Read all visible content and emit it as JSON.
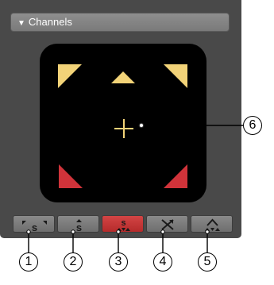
{
  "section": {
    "title": "Channels",
    "collapse_icon": "triangle-down-icon"
  },
  "speaker_display": {
    "background": "#000000",
    "front_speaker_color": "#f2d378",
    "rear_speaker_color": "#d0333a",
    "cursor_color": "#f2d378",
    "cursor_icon": "plus-icon"
  },
  "mode_buttons": [
    {
      "name": "mode-button-1",
      "icon": "surround-stereo-icon",
      "active": false
    },
    {
      "name": "mode-button-2",
      "icon": "center-stereo-icon",
      "active": false
    },
    {
      "name": "mode-button-3",
      "icon": "surround-full-icon",
      "active": true
    },
    {
      "name": "mode-button-4",
      "icon": "cross-arrows-icon",
      "active": false
    },
    {
      "name": "mode-button-5",
      "icon": "quad-arrows-icon",
      "active": false
    }
  ],
  "active_color": "#c43838",
  "callouts": [
    "1",
    "2",
    "3",
    "4",
    "5",
    "6"
  ]
}
